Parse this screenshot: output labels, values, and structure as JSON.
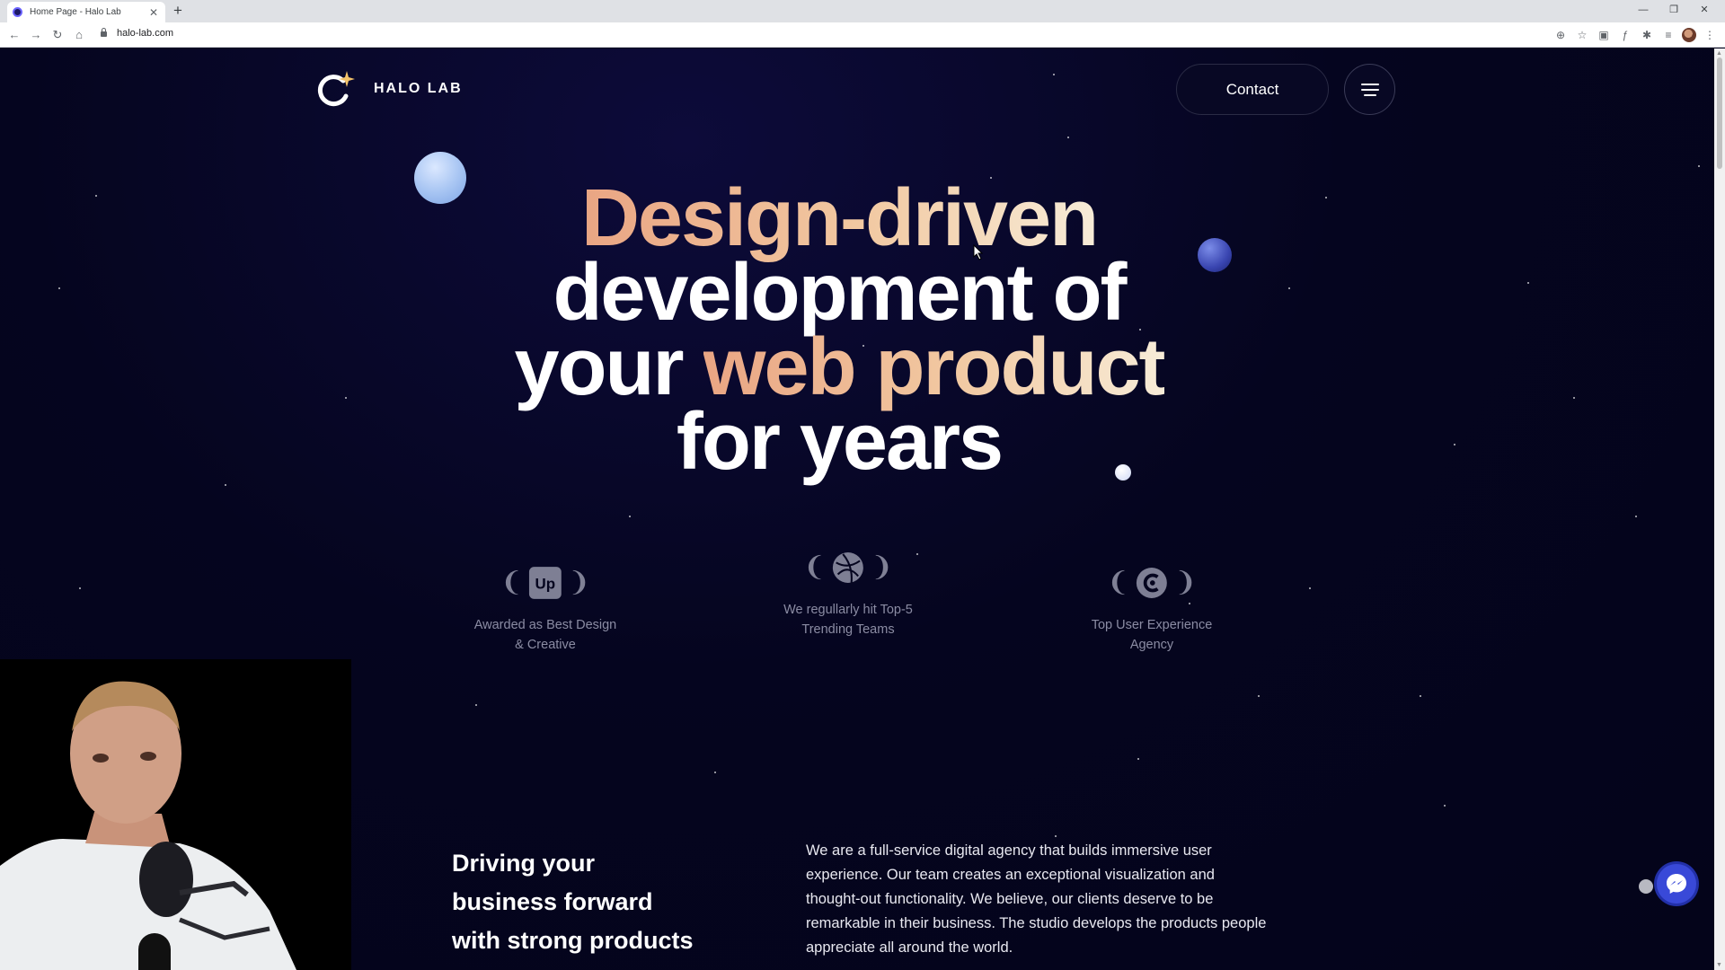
{
  "browser": {
    "tab_title": "Home Page - Halo Lab",
    "url": "halo-lab.com"
  },
  "header": {
    "logo_text": "HALO LAB",
    "contact_label": "Contact"
  },
  "hero": {
    "line1": "Design-driven",
    "line2": "development of",
    "line3_a": "your ",
    "line3_b": "web product",
    "line4": "for years"
  },
  "awards": [
    {
      "icon": "upwork-icon",
      "text_line1": "Awarded as Best Design",
      "text_line2": "& Creative"
    },
    {
      "icon": "dribbble-icon",
      "text_line1": "We regullarly hit Top-5",
      "text_line2": "Trending Teams"
    },
    {
      "icon": "clutch-icon",
      "text_line1": "Top User Experience",
      "text_line2": "Agency"
    }
  ],
  "about": {
    "heading_line1": "Driving your",
    "heading_line2": "business forward",
    "heading_line3": "with strong products",
    "body": "We are a full-service digital agency that builds immersive user experience. Our team creates an exceptional visualization and thought-out functionality. We believe, our clients deserve to be remarkable in their business. The studio develops the products people appreciate all around the world."
  },
  "colors": {
    "background": "#05051f",
    "accent_gradient_start": "#e9a583",
    "accent_gradient_end": "#f7ecd8",
    "chat_button": "#3949d8"
  }
}
